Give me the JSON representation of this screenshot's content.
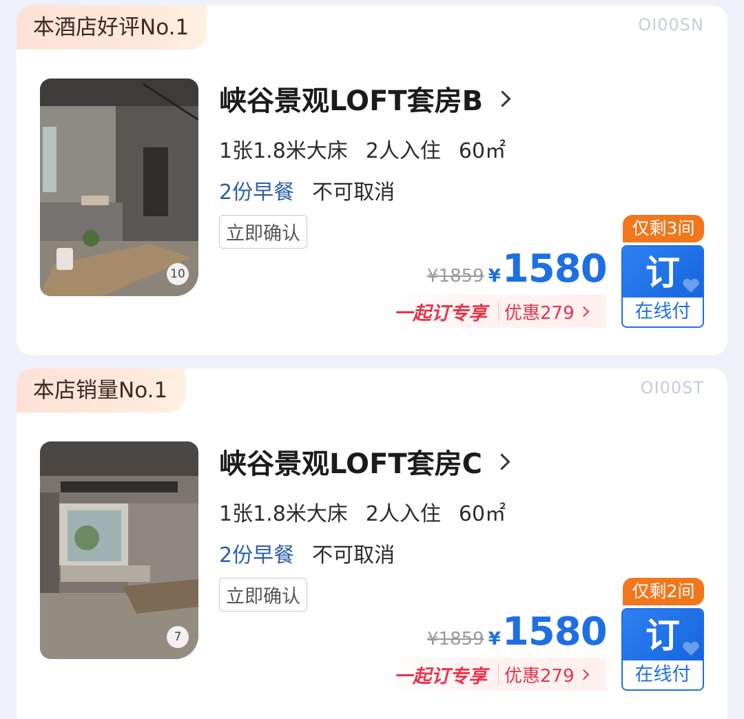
{
  "rooms": [
    {
      "ribbon": "本酒店好评No.1",
      "code": "OI00SN",
      "photo_count": "10",
      "title": "峡谷景观LOFT套房B",
      "bed": "1张1.8米大床",
      "guests": "2人入住",
      "area": "60㎡",
      "breakfast": "2份早餐",
      "cancel": "不可取消",
      "confirm": "立即确认",
      "original_price": "¥1859",
      "currency": "¥",
      "price": "1580",
      "promo_label": "一起订专享",
      "promo_discount": "优惠279",
      "rooms_left": "仅剩3间",
      "book_label": "订",
      "pay_label": "在线付"
    },
    {
      "ribbon": "本店销量No.1",
      "code": "OI00ST",
      "photo_count": "7",
      "title": "峡谷景观LOFT套房C",
      "bed": "1张1.8米大床",
      "guests": "2人入住",
      "area": "60㎡",
      "breakfast": "2份早餐",
      "cancel": "不可取消",
      "confirm": "立即确认",
      "original_price": "¥1859",
      "currency": "¥",
      "price": "1580",
      "promo_label": "一起订专享",
      "promo_discount": "优惠279",
      "rooms_left": "仅剩2间",
      "book_label": "订",
      "pay_label": "在线付"
    }
  ],
  "colors": {
    "price_blue": "#1e6fe4",
    "promo_red": "#e8334a",
    "badge_orange": "#f2761c",
    "breakfast_blue": "#2b5fa8"
  },
  "icons": [
    "chevron-right-icon",
    "heart-icon"
  ]
}
